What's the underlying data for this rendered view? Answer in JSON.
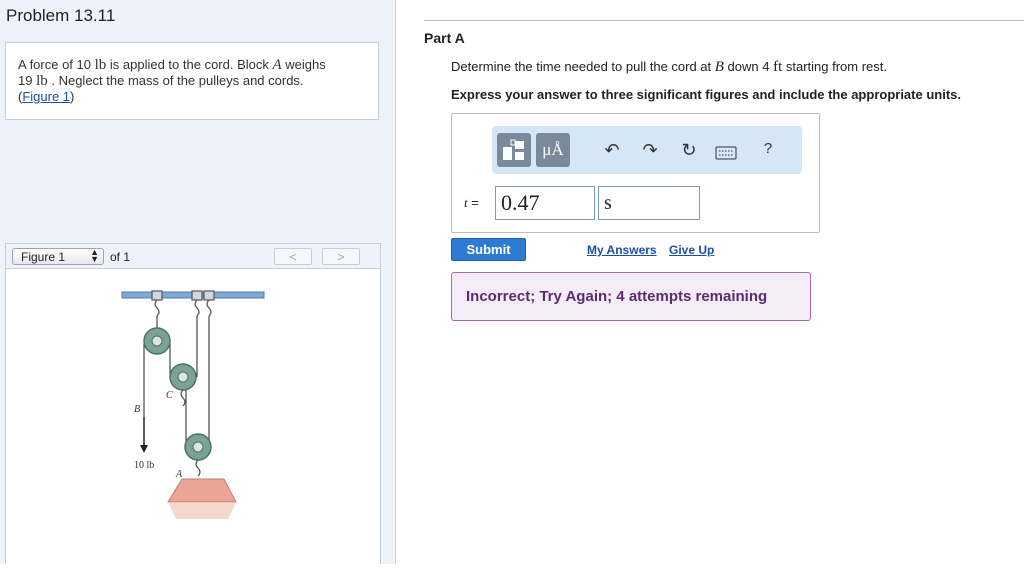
{
  "left": {
    "problem_title": "Problem 13.11",
    "problem": {
      "t1": "A force of 10 ",
      "t2": "lb",
      "t3": " is applied to the cord. Block ",
      "t4": "A",
      "t5": " weighs",
      "t6": "19 ",
      "t7": "lb",
      "t8": " . Neglect the mass of the pulleys and cords.",
      "t9": "(",
      "link": "Figure 1",
      "t10": ")"
    },
    "figure_select": "Figure 1",
    "figure_of": "of 1",
    "prev": "<",
    "next": ">",
    "figure": {
      "label_b": "B",
      "label_c": "C",
      "label_a": "A",
      "label_force": "10 lb"
    }
  },
  "right": {
    "part_title": "Part A",
    "question": {
      "q1": "Determine the time needed to pull the cord at ",
      "q2": "B",
      "q3": " down 4 ",
      "q4": "ft",
      "q5": " starting from rest."
    },
    "instruction": "Express your answer to three significant figures and include the appropriate units.",
    "toolbar": {
      "units_label": "μÅ",
      "help_label": "?"
    },
    "answer_label_var": "t",
    "answer_label_eq": " =",
    "answer_value": "0.47",
    "answer_unit": "s",
    "submit": "Submit",
    "my_answers": "My Answers",
    "give_up": "Give Up",
    "feedback": "Incorrect; Try Again; 4 attempts remaining"
  }
}
